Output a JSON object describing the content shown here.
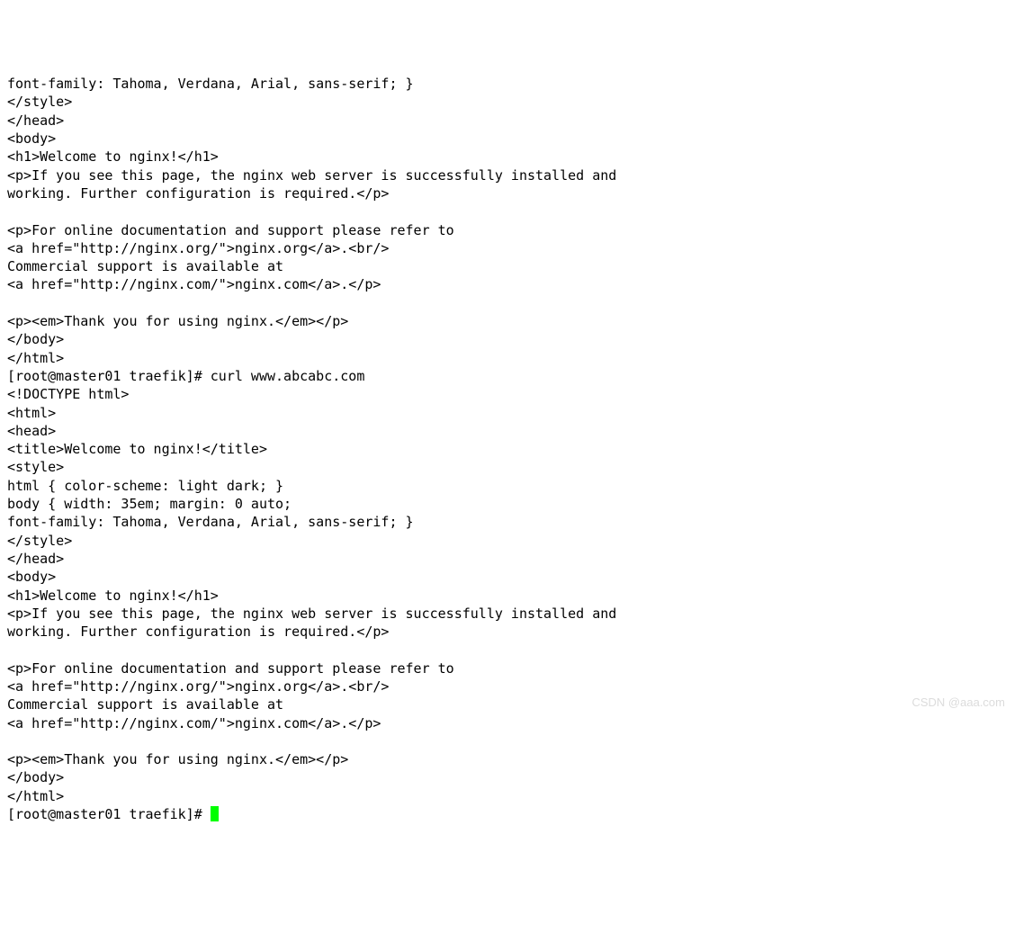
{
  "terminal": {
    "lines": {
      "l0": "font-family: Tahoma, Verdana, Arial, sans-serif; }",
      "l1": "</style>",
      "l2": "</head>",
      "l3": "<body>",
      "l4": "<h1>Welcome to nginx!</h1>",
      "l5": "<p>If you see this page, the nginx web server is successfully installed and",
      "l6": "working. Further configuration is required.</p>",
      "l7": "",
      "l8": "<p>For online documentation and support please refer to",
      "l9": "<a href=\"http://nginx.org/\">nginx.org</a>.<br/>",
      "l10": "Commercial support is available at",
      "l11": "<a href=\"http://nginx.com/\">nginx.com</a>.</p>",
      "l12": "",
      "l13": "<p><em>Thank you for using nginx.</em></p>",
      "l14": "</body>",
      "l15": "</html>",
      "l16": "[root@master01 traefik]# curl www.abcabc.com",
      "l17": "<!DOCTYPE html>",
      "l18": "<html>",
      "l19": "<head>",
      "l20": "<title>Welcome to nginx!</title>",
      "l21": "<style>",
      "l22": "html { color-scheme: light dark; }",
      "l23": "body { width: 35em; margin: 0 auto;",
      "l24": "font-family: Tahoma, Verdana, Arial, sans-serif; }",
      "l25": "</style>",
      "l26": "</head>",
      "l27": "<body>",
      "l28": "<h1>Welcome to nginx!</h1>",
      "l29": "<p>If you see this page, the nginx web server is successfully installed and",
      "l30": "working. Further configuration is required.</p>",
      "l31": "",
      "l32": "<p>For online documentation and support please refer to",
      "l33": "<a href=\"http://nginx.org/\">nginx.org</a>.<br/>",
      "l34": "Commercial support is available at",
      "l35": "<a href=\"http://nginx.com/\">nginx.com</a>.</p>",
      "l36": "",
      "l37": "<p><em>Thank you for using nginx.</em></p>",
      "l38": "</body>",
      "l39": "</html>"
    },
    "prompt": "[root@master01 traefik]# "
  },
  "watermark": "CSDN @aaa.com"
}
